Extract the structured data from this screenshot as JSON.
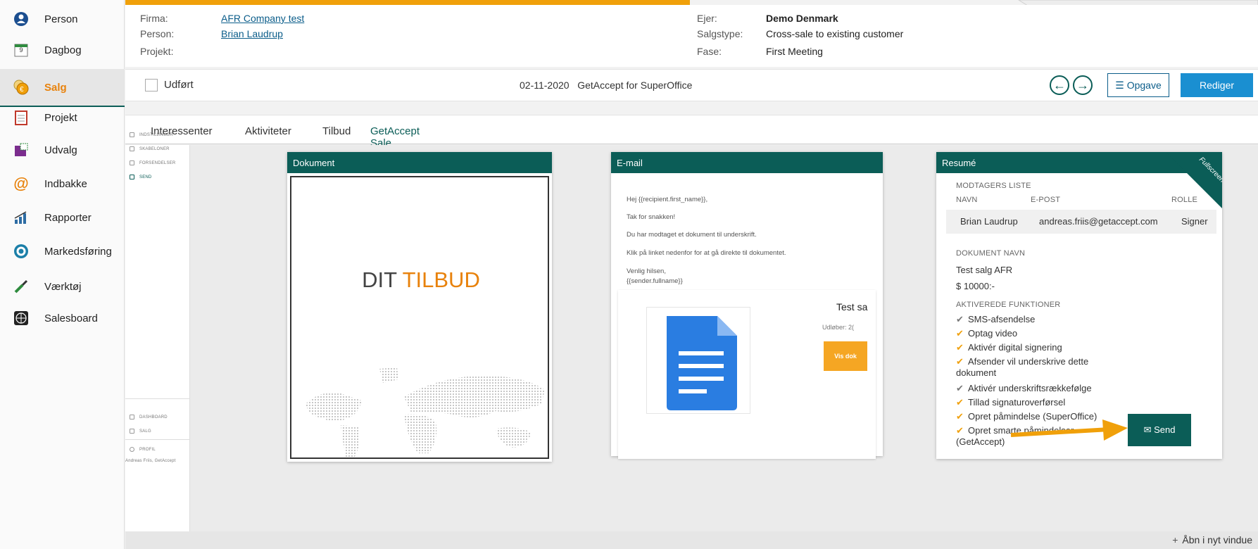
{
  "nav": {
    "items": [
      {
        "label": "Person",
        "icon": "person-icon"
      },
      {
        "label": "Dagbog",
        "icon": "calendar-icon"
      },
      {
        "label": "Salg",
        "icon": "sale-icon"
      },
      {
        "label": "Projekt",
        "icon": "project-icon"
      },
      {
        "label": "Udvalg",
        "icon": "selection-icon"
      },
      {
        "label": "Indbakke",
        "icon": "inbox-icon"
      },
      {
        "label": "Rapporter",
        "icon": "reports-icon"
      },
      {
        "label": "Markedsføring",
        "icon": "marketing-icon"
      },
      {
        "label": "Værktøj",
        "icon": "tools-icon"
      },
      {
        "label": "Salesboard",
        "icon": "salesboard-icon"
      }
    ],
    "calendar_day": "9"
  },
  "header": {
    "firma_label": "Firma:",
    "firma_value": "AFR Company test",
    "person_label": "Person:",
    "person_value": "Brian Laudrup",
    "projekt_label": "Projekt:",
    "ejer_label": "Ejer:",
    "ejer_value": "Demo Denmark",
    "salgstype_label": "Salgstype:",
    "salgstype_value": "Cross-sale to existing customer",
    "fase_label": "Fase:",
    "fase_value": "First Meeting"
  },
  "actbar": {
    "done_label": "Udført",
    "title": "02-11-2020   GetAccept for SuperOffice",
    "task_label": "☰ Opgave",
    "edit_label": "Rediger"
  },
  "tabs": [
    "Interessenter",
    "Aktiviteter",
    "Tilbud",
    "GetAccept Sale"
  ],
  "ga_sidebar": {
    "top": [
      "INDSTILLINGER",
      "SKABELONER",
      "FORSENDELSER",
      "SEND"
    ],
    "bottom": [
      "DASHBOARD",
      "SALG",
      "PROFIL"
    ],
    "user": "Andreas Friis, GetAccept"
  },
  "document_panel": {
    "header": "Dokument",
    "title_plain": "DIT ",
    "title_accent": "TILBUD"
  },
  "email_panel": {
    "header": "E-mail",
    "lines": [
      "Hej {{recipient.first_name}},",
      "Tak for snakken!",
      "Du har modtaget et dokument til underskrift.",
      "Klik på linket nedenfor for at gå direkte til dokumentet.",
      "Venlig hilsen,",
      "{{sender.fullname}}"
    ],
    "card_title": "Test sa",
    "card_expiry": "Udløber: 2(",
    "card_button": "Vis dok"
  },
  "resume_panel": {
    "header": "Resumé",
    "fullscreen": "Fullscreen",
    "recipients_title": "MODTAGERS LISTE",
    "col_name": "NAVN",
    "col_email": "E-POST",
    "col_role": "ROLLE",
    "recipient": {
      "name": "Brian Laudrup",
      "email": "andreas.friis@getaccept.com",
      "role": "Signer"
    },
    "docname_title": "DOKUMENT NAVN",
    "docname": "Test salg AFR",
    "value": "$ 10000:-",
    "features_title": "AKTIVEREDE FUNKTIONER",
    "features": [
      {
        "label": "SMS-afsendelse",
        "color": "grey"
      },
      {
        "label": "Optag video",
        "color": "orange"
      },
      {
        "label": "Aktivér digital signering",
        "color": "orange"
      },
      {
        "label": "Afsender vil underskrive dette",
        "color": "orange"
      },
      {
        "label": "dokument",
        "color": "none"
      },
      {
        "label": "Aktivér underskriftsrækkefølge",
        "color": "grey"
      },
      {
        "label": "Tillad signaturoverførsel",
        "color": "orange"
      },
      {
        "label": "Opret påmindelse (SuperOffice)",
        "color": "orange"
      },
      {
        "label": "Opret smarte påmindelser",
        "color": "orange"
      },
      {
        "label": "(GetAccept)",
        "color": "none"
      }
    ],
    "send_label": "✉ Send"
  },
  "bottombar": {
    "open_new": "Åbn i nyt vindue"
  },
  "colors": {
    "brand": "#0b5d57",
    "accent": "#f0a00a",
    "primary_button": "#1a8fd1"
  }
}
